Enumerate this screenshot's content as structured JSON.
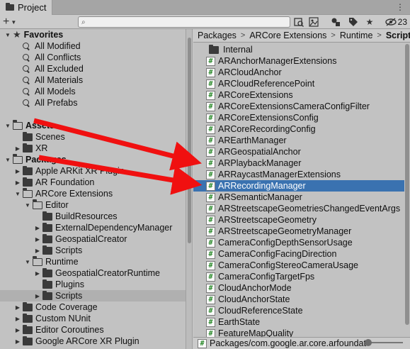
{
  "tab": {
    "title": "Project"
  },
  "toolbar": {
    "add_label": "+",
    "search_placeholder": "",
    "hidden_count": "23"
  },
  "left_tree": [
    {
      "label": "Favorites",
      "kind": "star",
      "depth": 0,
      "expanded": true,
      "bold": true,
      "name": "favorites-header"
    },
    {
      "label": "All Modified",
      "kind": "search",
      "depth": 1,
      "name": "favorite-all-modified"
    },
    {
      "label": "All Conflicts",
      "kind": "search",
      "depth": 1,
      "name": "favorite-all-conflicts"
    },
    {
      "label": "All Excluded",
      "kind": "search",
      "depth": 1,
      "name": "favorite-all-excluded"
    },
    {
      "label": "All Materials",
      "kind": "search",
      "depth": 1,
      "name": "favorite-all-materials"
    },
    {
      "label": "All Models",
      "kind": "search",
      "depth": 1,
      "name": "favorite-all-models"
    },
    {
      "label": "All Prefabs",
      "kind": "search",
      "depth": 1,
      "name": "favorite-all-prefabs"
    },
    {
      "label": "",
      "kind": "spacer",
      "depth": 0,
      "name": "spacer"
    },
    {
      "label": "Assets",
      "kind": "folder-open",
      "depth": 0,
      "expanded": true,
      "bold": true,
      "name": "assets-folder"
    },
    {
      "label": "Scenes",
      "kind": "folder",
      "depth": 1,
      "leaf": true,
      "name": "folder-scenes"
    },
    {
      "label": "XR",
      "kind": "folder",
      "depth": 1,
      "expanded": false,
      "name": "folder-xr"
    },
    {
      "label": "Packages",
      "kind": "folder-open",
      "depth": 0,
      "expanded": true,
      "bold": true,
      "name": "packages-folder"
    },
    {
      "label": "Apple ARKit XR Plugin",
      "kind": "folder",
      "depth": 1,
      "expanded": false,
      "name": "package-apple-arkit"
    },
    {
      "label": "AR Foundation",
      "kind": "folder",
      "depth": 1,
      "expanded": false,
      "name": "package-ar-foundation"
    },
    {
      "label": "ARCore Extensions",
      "kind": "folder-open",
      "depth": 1,
      "expanded": true,
      "name": "package-arcore-extensions"
    },
    {
      "label": "Editor",
      "kind": "folder-open",
      "depth": 2,
      "expanded": true,
      "name": "folder-editor"
    },
    {
      "label": "BuildResources",
      "kind": "folder",
      "depth": 3,
      "leaf": true,
      "name": "folder-buildresources"
    },
    {
      "label": "ExternalDependencyManager",
      "kind": "folder",
      "depth": 3,
      "expanded": false,
      "name": "folder-externaldependencymanager"
    },
    {
      "label": "GeospatialCreator",
      "kind": "folder",
      "depth": 3,
      "expanded": false,
      "name": "folder-geospatialcreator"
    },
    {
      "label": "Scripts",
      "kind": "folder",
      "depth": 3,
      "expanded": false,
      "name": "folder-editor-scripts"
    },
    {
      "label": "Runtime",
      "kind": "folder-open",
      "depth": 2,
      "expanded": true,
      "name": "folder-runtime"
    },
    {
      "label": "GeospatialCreatorRuntime",
      "kind": "folder",
      "depth": 3,
      "expanded": false,
      "name": "folder-geospatialcreatorruntime"
    },
    {
      "label": "Plugins",
      "kind": "folder",
      "depth": 3,
      "leaf": true,
      "name": "folder-plugins"
    },
    {
      "label": "Scripts",
      "kind": "folder",
      "depth": 3,
      "expanded": false,
      "selected": true,
      "name": "folder-runtime-scripts"
    },
    {
      "label": "Code Coverage",
      "kind": "folder",
      "depth": 1,
      "expanded": false,
      "name": "package-code-coverage"
    },
    {
      "label": "Custom NUnit",
      "kind": "folder",
      "depth": 1,
      "expanded": false,
      "name": "package-custom-nunit"
    },
    {
      "label": "Editor Coroutines",
      "kind": "folder",
      "depth": 1,
      "expanded": false,
      "name": "package-editor-coroutines"
    },
    {
      "label": "Google ARCore XR Plugin",
      "kind": "folder",
      "depth": 1,
      "expanded": false,
      "name": "package-google-arcore-xr"
    }
  ],
  "breadcrumb": [
    "Packages",
    "ARCore Extensions",
    "Runtime",
    "Scripts"
  ],
  "files": [
    {
      "label": "Internal",
      "kind": "folder"
    },
    {
      "label": "ARAnchorManagerExtensions",
      "kind": "script"
    },
    {
      "label": "ARCloudAnchor",
      "kind": "script"
    },
    {
      "label": "ARCloudReferencePoint",
      "kind": "script"
    },
    {
      "label": "ARCoreExtensions",
      "kind": "script"
    },
    {
      "label": "ARCoreExtensionsCameraConfigFilter",
      "kind": "script"
    },
    {
      "label": "ARCoreExtensionsConfig",
      "kind": "script"
    },
    {
      "label": "ARCoreRecordingConfig",
      "kind": "script"
    },
    {
      "label": "AREarthManager",
      "kind": "script"
    },
    {
      "label": "ARGeospatialAnchor",
      "kind": "script"
    },
    {
      "label": "ARPlaybackManager",
      "kind": "script"
    },
    {
      "label": "ARRaycastManagerExtensions",
      "kind": "script"
    },
    {
      "label": "ARRecordingManager",
      "kind": "script",
      "selected": true
    },
    {
      "label": "ARSemanticManager",
      "kind": "script"
    },
    {
      "label": "ARStreetscapeGeometriesChangedEventArgs",
      "kind": "script"
    },
    {
      "label": "ARStreetscapeGeometry",
      "kind": "script"
    },
    {
      "label": "ARStreetscapeGeometryManager",
      "kind": "script"
    },
    {
      "label": "CameraConfigDepthSensorUsage",
      "kind": "script"
    },
    {
      "label": "CameraConfigFacingDirection",
      "kind": "script"
    },
    {
      "label": "CameraConfigStereoCameraUsage",
      "kind": "script"
    },
    {
      "label": "CameraConfigTargetFps",
      "kind": "script"
    },
    {
      "label": "CloudAnchorMode",
      "kind": "script"
    },
    {
      "label": "CloudAnchorState",
      "kind": "script"
    },
    {
      "label": "CloudReferenceState",
      "kind": "script"
    },
    {
      "label": "EarthState",
      "kind": "script"
    },
    {
      "label": "FeatureMapQuality",
      "kind": "script"
    }
  ],
  "status": {
    "path": "Packages/com.google.ar.core.arfoundation.extensions/Runtime/Scripts/ARRecordingManager.cs"
  },
  "colors": {
    "selection": "#3a72b0",
    "annotation_arrow": "#f01010"
  }
}
